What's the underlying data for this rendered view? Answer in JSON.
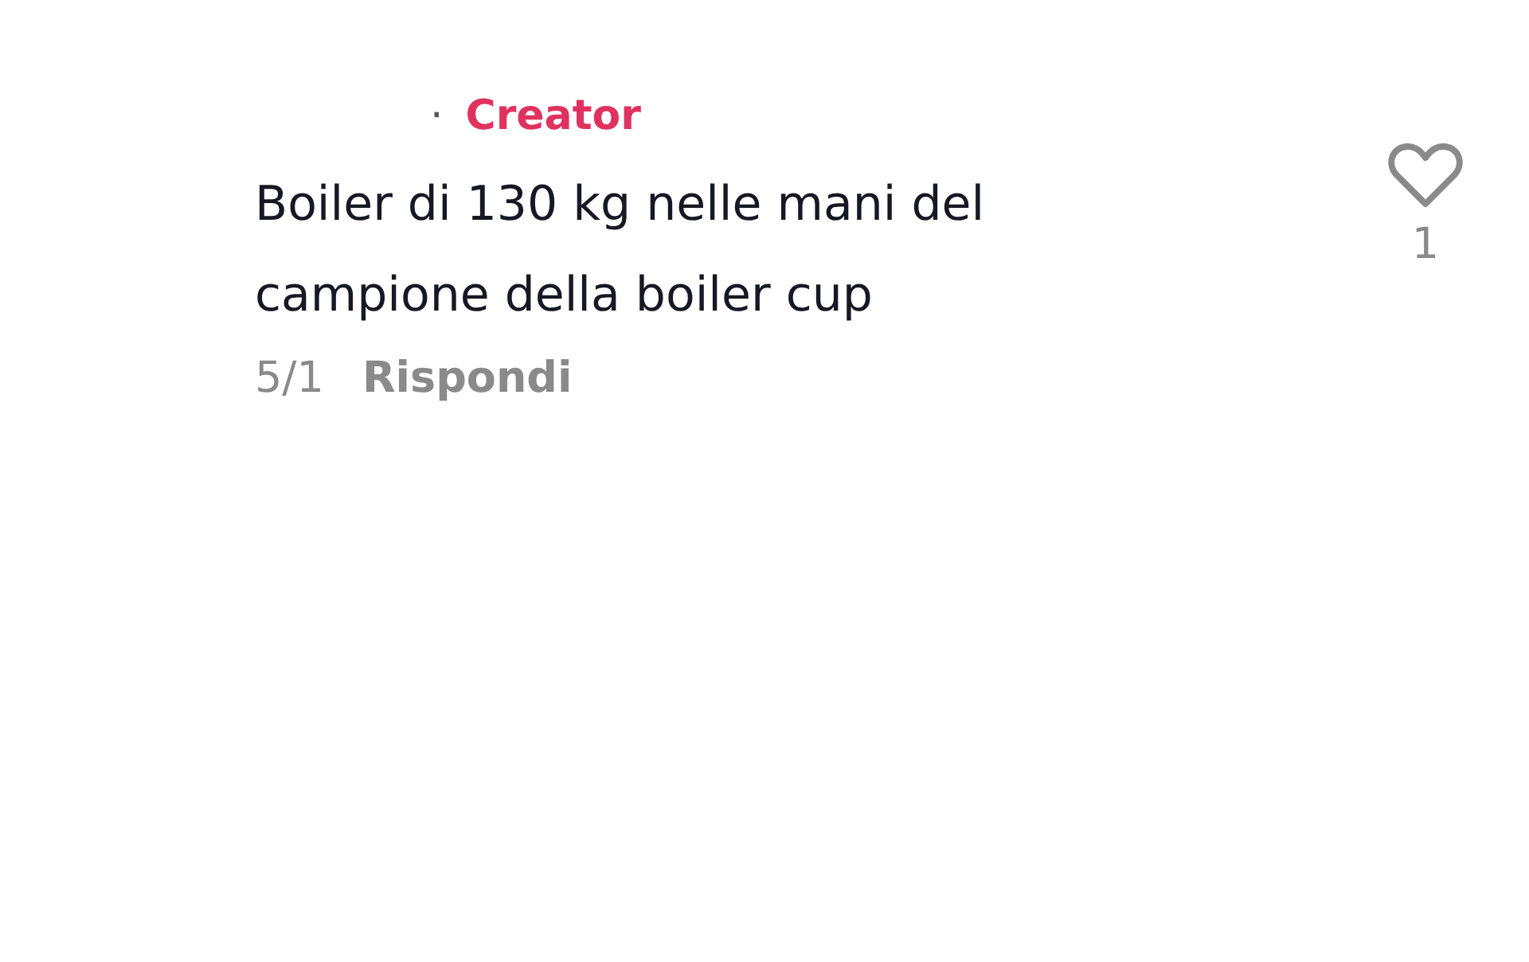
{
  "comment": {
    "separator": "·",
    "badge": "Creator",
    "text": "Boiler di 130 kg nelle mani del campione della boiler cup",
    "date": "5/1",
    "reply_label": "Rispondi",
    "liked": false,
    "like_count": "1"
  }
}
